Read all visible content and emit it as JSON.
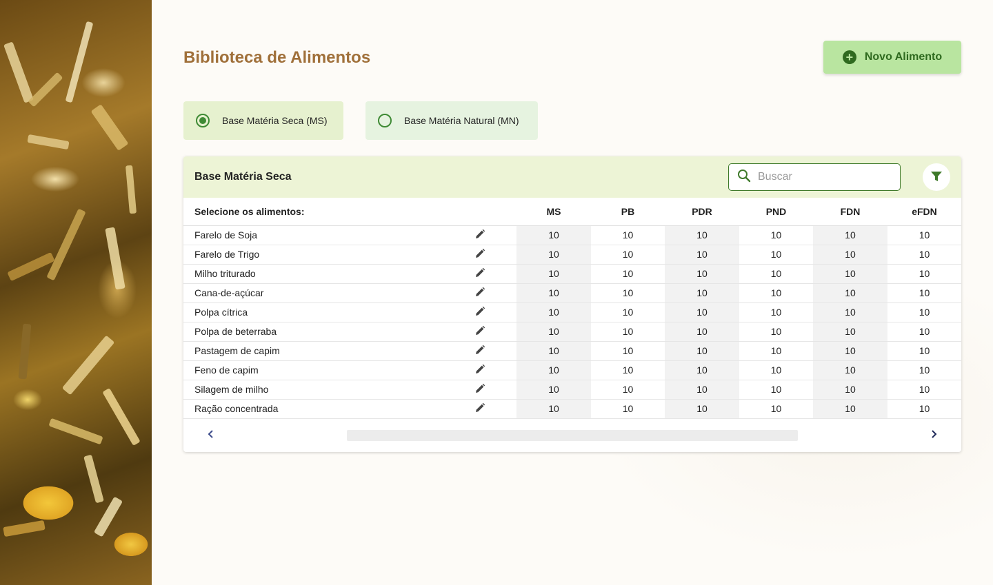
{
  "header": {
    "title": "Biblioteca de Alimentos",
    "new_button_label": "Novo Alimento"
  },
  "basis_options": [
    {
      "label": "Base Matéria Seca (MS)",
      "selected": true
    },
    {
      "label": "Base Matéria Natural (MN)",
      "selected": false
    }
  ],
  "table_card": {
    "title": "Base Matéria Seca",
    "search_placeholder": "Buscar",
    "select_label": "Selecione os alimentos:",
    "columns": [
      "MS",
      "PB",
      "PDR",
      "PND",
      "FDN",
      "eFDN"
    ],
    "rows": [
      {
        "name": "Farelo de Soja",
        "values": [
          "10",
          "10",
          "10",
          "10",
          "10",
          "10"
        ]
      },
      {
        "name": "Farelo de Trigo",
        "values": [
          "10",
          "10",
          "10",
          "10",
          "10",
          "10"
        ]
      },
      {
        "name": "Milho triturado",
        "values": [
          "10",
          "10",
          "10",
          "10",
          "10",
          "10"
        ]
      },
      {
        "name": "Cana-de-açúcar",
        "values": [
          "10",
          "10",
          "10",
          "10",
          "10",
          "10"
        ]
      },
      {
        "name": "Polpa cítrica",
        "values": [
          "10",
          "10",
          "10",
          "10",
          "10",
          "10"
        ]
      },
      {
        "name": "Polpa de beterraba",
        "values": [
          "10",
          "10",
          "10",
          "10",
          "10",
          "10"
        ]
      },
      {
        "name": "Pastagem de capim",
        "values": [
          "10",
          "10",
          "10",
          "10",
          "10",
          "10"
        ]
      },
      {
        "name": "Feno de capim",
        "values": [
          "10",
          "10",
          "10",
          "10",
          "10",
          "10"
        ]
      },
      {
        "name": "Silagem de milho",
        "values": [
          "10",
          "10",
          "10",
          "10",
          "10",
          "10"
        ]
      },
      {
        "name": "Ração concentrada",
        "values": [
          "10",
          "10",
          "10",
          "10",
          "10",
          "10"
        ]
      }
    ]
  },
  "icons": {
    "add": "plus-circle-icon",
    "search": "search-icon",
    "filter": "filter-icon",
    "edit": "pencil-icon",
    "prev": "chevron-left-icon",
    "next": "chevron-right-icon"
  },
  "colors": {
    "title": "#a0703a",
    "primary_button_bg": "#b9e5a0",
    "primary_button_text": "#2f6a1f",
    "accent_green": "#3f8a35",
    "table_header_bg": "#edf4d6"
  }
}
